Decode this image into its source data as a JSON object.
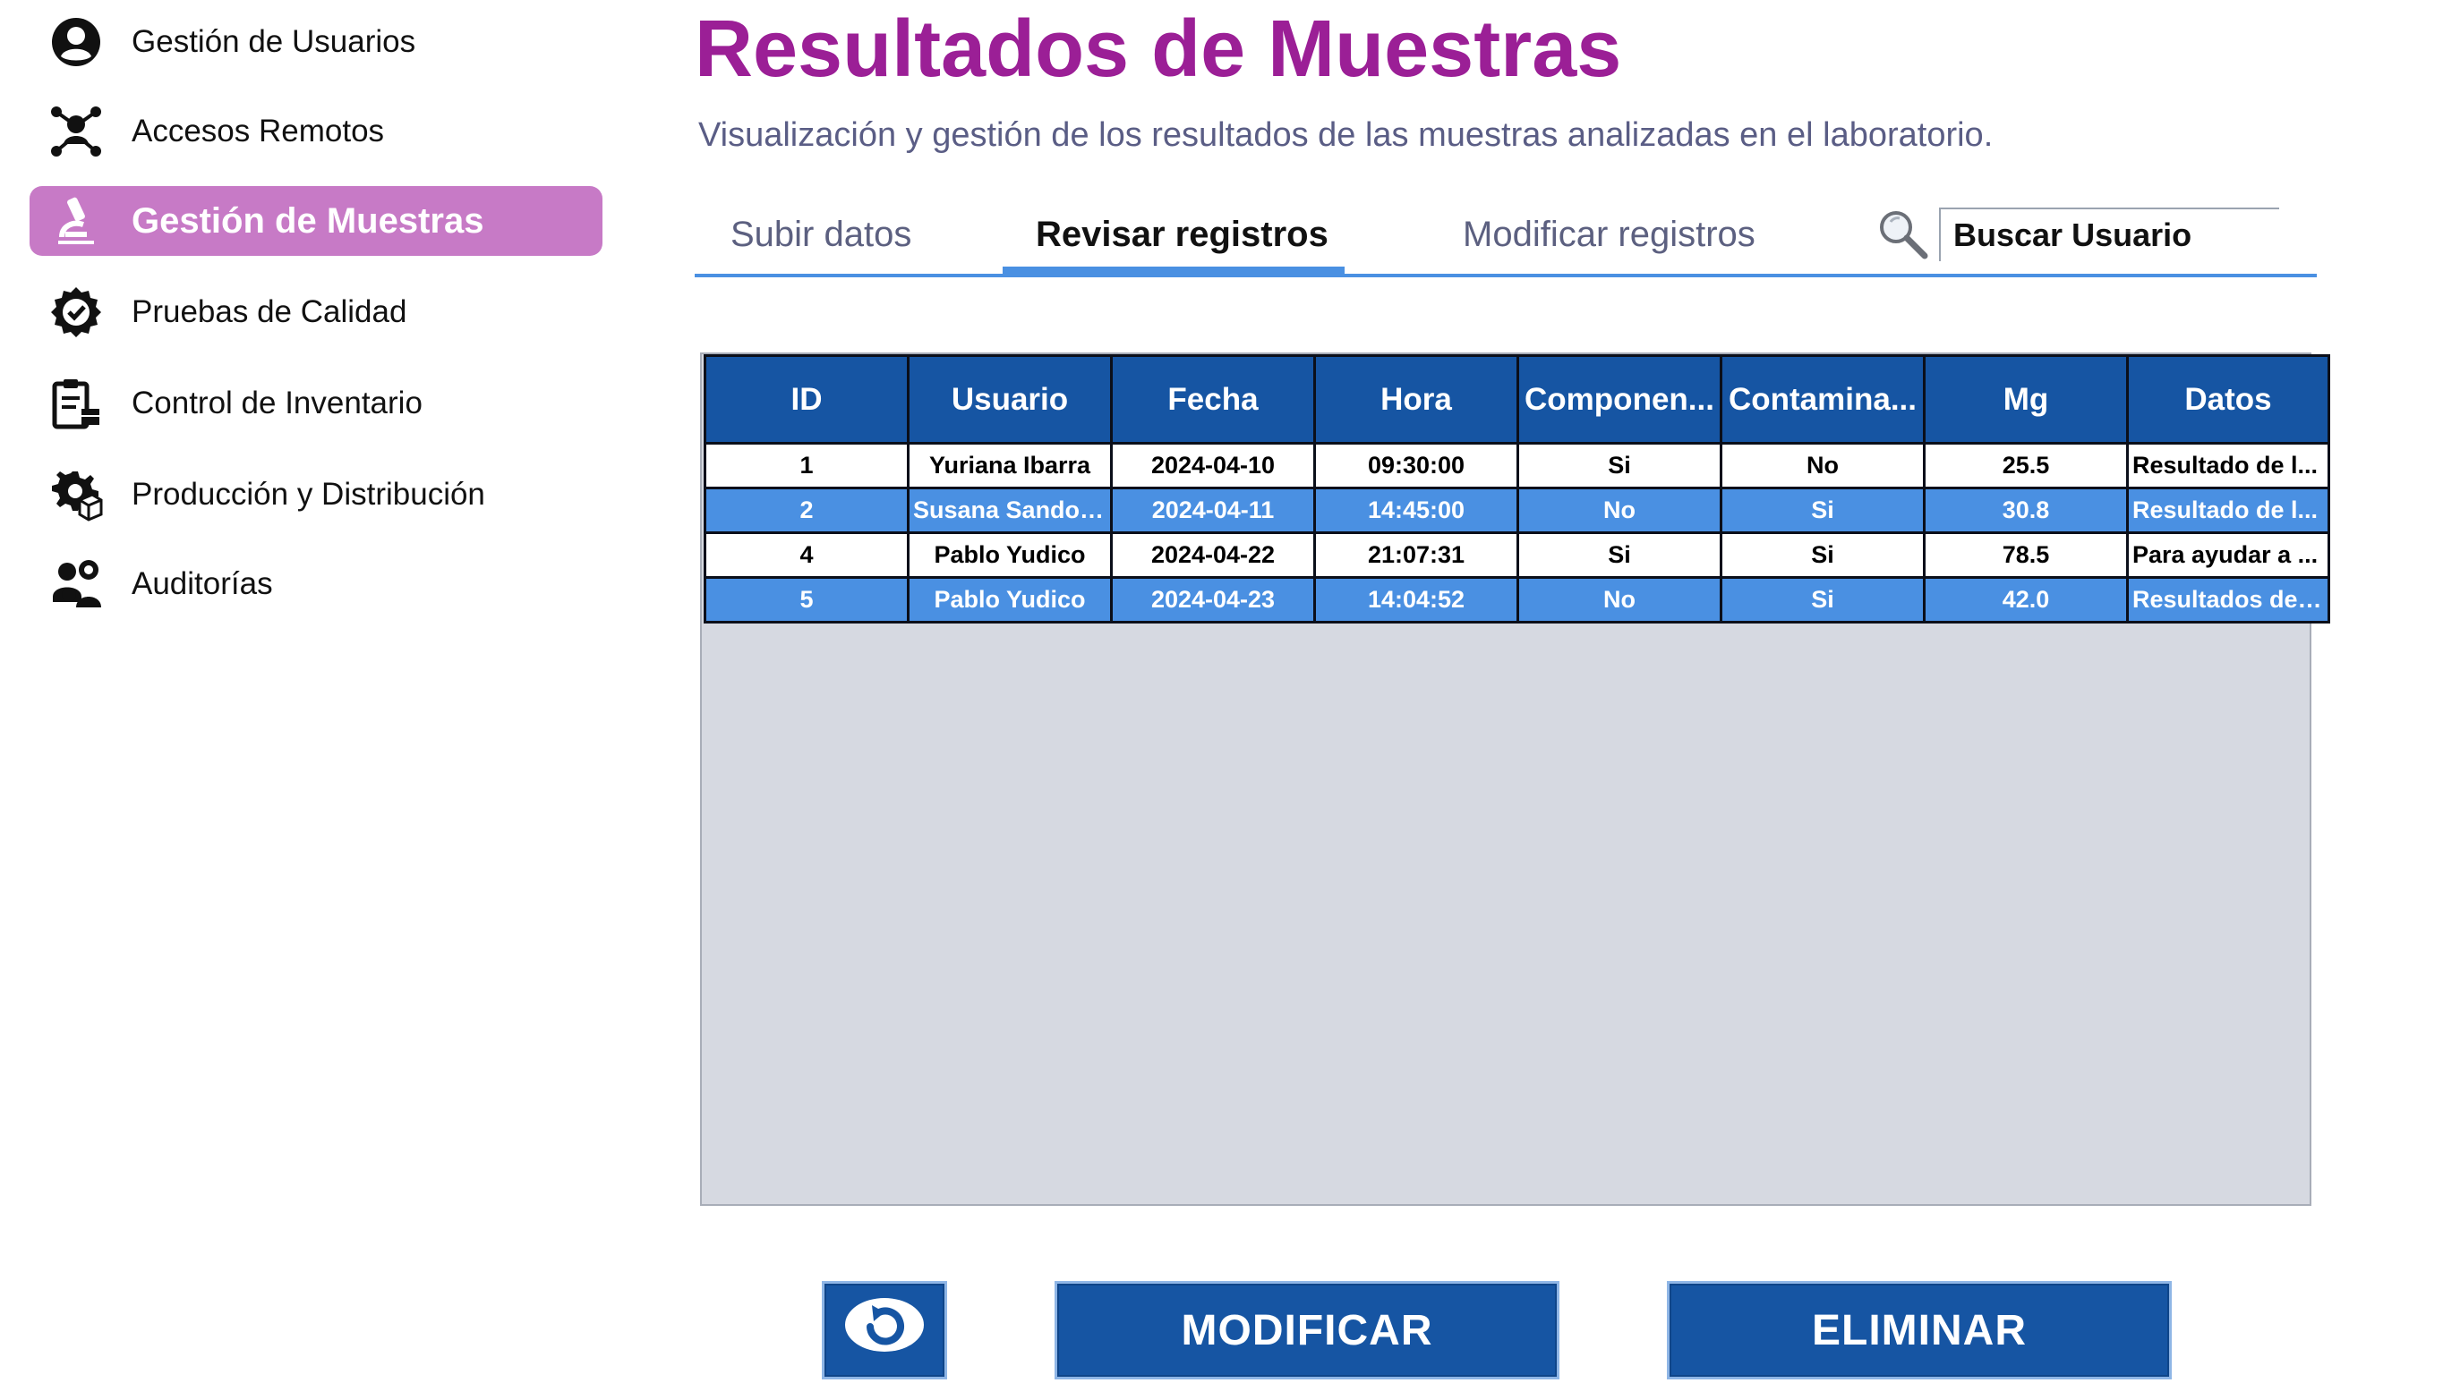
{
  "sidebar": {
    "items": [
      {
        "label": "Gestión de Usuarios",
        "icon": "user-circle-icon"
      },
      {
        "label": "Accesos Remotos",
        "icon": "remote-access-icon"
      },
      {
        "label": "Gestión de Muestras",
        "icon": "microscope-icon",
        "active": true
      },
      {
        "label": "Pruebas de Calidad",
        "icon": "quality-badge-icon"
      },
      {
        "label": "Control de Inventario",
        "icon": "clipboard-inventory-icon"
      },
      {
        "label": "Producción y Distribución",
        "icon": "gear-box-icon"
      },
      {
        "label": "Auditorías",
        "icon": "people-audit-icon"
      }
    ]
  },
  "header": {
    "title": "Resultados de Muestras",
    "subtitle": "Visualización y gestión de los resultados de las muestras analizadas en el laboratorio."
  },
  "tabs": [
    {
      "label": "Subir datos"
    },
    {
      "label": "Revisar registros",
      "active": true
    },
    {
      "label": "Modificar registros"
    }
  ],
  "search": {
    "placeholder": "Buscar Usuario"
  },
  "table": {
    "columns": [
      "ID",
      "Usuario",
      "Fecha",
      "Hora",
      "Componen...",
      "Contamina...",
      "Mg",
      "Datos"
    ],
    "rows": [
      {
        "id": "1",
        "usuario": "Yuriana Ibarra",
        "fecha": "2024-04-10",
        "hora": "09:30:00",
        "componente": "Si",
        "contaminante": "No",
        "mg": "25.5",
        "datos": "Resultado de l...",
        "selected": false
      },
      {
        "id": "2",
        "usuario": "Susana Sandoval",
        "fecha": "2024-04-11",
        "hora": "14:45:00",
        "componente": "No",
        "contaminante": "Si",
        "mg": "30.8",
        "datos": "Resultado de l...",
        "selected": true
      },
      {
        "id": "4",
        "usuario": "Pablo Yudico",
        "fecha": "2024-04-22",
        "hora": "21:07:31",
        "componente": "Si",
        "contaminante": "Si",
        "mg": "78.5",
        "datos": "Para ayudar a ...",
        "selected": false
      },
      {
        "id": "5",
        "usuario": "Pablo Yudico",
        "fecha": "2024-04-23",
        "hora": "14:04:52",
        "componente": "No",
        "contaminante": "Si",
        "mg": "42.0",
        "datos": "Resultados de ...",
        "selected": true
      }
    ]
  },
  "buttons": {
    "refresh_icon": "refresh-icon",
    "modify_label": "MODIFICAR",
    "delete_label": "ELIMINAR"
  },
  "colors": {
    "accent_purple": "#9b1f96",
    "sidebar_active": "#c77ac6",
    "header_blue": "#1655a3",
    "selected_row": "#4a90e2"
  }
}
